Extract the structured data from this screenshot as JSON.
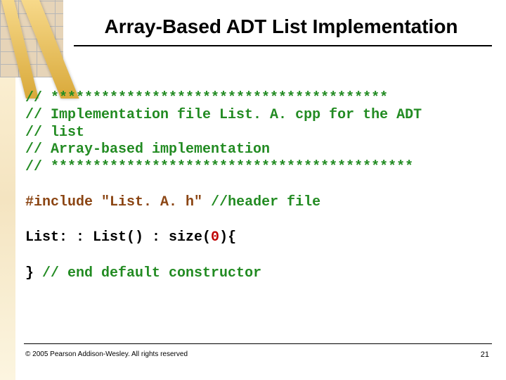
{
  "title": "Array-Based ADT List Implementation",
  "code_comments": {
    "l1": "// ****************************************",
    "l2": "// Implementation file List. A. cpp for the ADT",
    "l3": "// list",
    "l4": "// Array-based implementation",
    "l5": "// *******************************************"
  },
  "include": {
    "directive": "#include ",
    "file": "\"List. A. h\"",
    "tail": "  //header file"
  },
  "ctor_line": {
    "pre": "List: : List() : size(",
    "zero": "0",
    "post": "){"
  },
  "end_line": {
    "brace": "}  ",
    "comment": "// end default constructor"
  },
  "footer": "© 2005 Pearson Addison-Wesley. All rights reserved",
  "pagenum": "21"
}
